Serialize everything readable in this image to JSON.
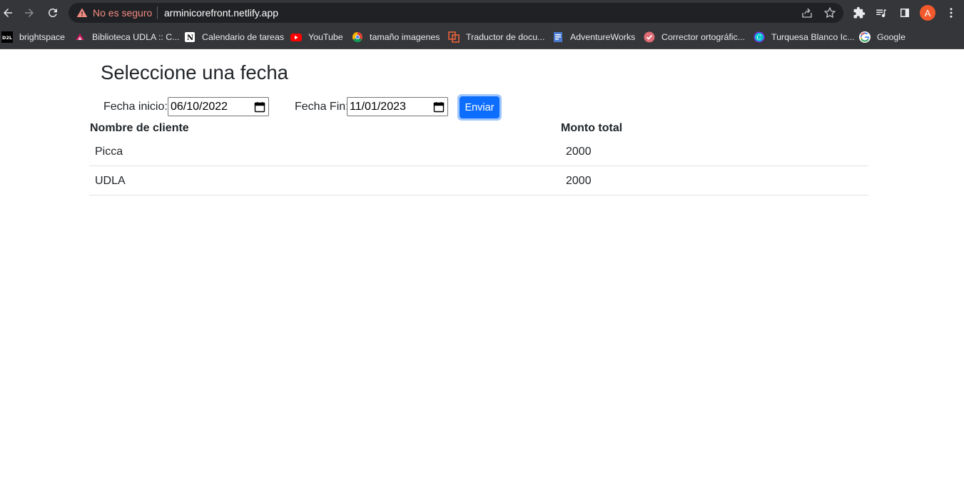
{
  "browser": {
    "security_text": "No es seguro",
    "url": "arminicorefront.netlify.app",
    "profile_initial": "A",
    "accent_color": "#f25a2c",
    "warning_color": "#f28b82",
    "icons": [
      "back-arrow-icon",
      "forward-arrow-icon",
      "reload-icon",
      "warning-icon",
      "share-icon",
      "star-icon",
      "puzzle-icon",
      "media-queue-icon",
      "side-panel-icon",
      "kebab-menu-icon"
    ]
  },
  "bookmarks": [
    {
      "label": "brightspace",
      "icon": "d2l-icon"
    },
    {
      "label": "Biblioteca UDLA :: C...",
      "icon": "udla-icon"
    },
    {
      "label": "Calendario de tareas",
      "icon": "notion-icon"
    },
    {
      "label": "YouTube",
      "icon": "youtube-icon"
    },
    {
      "label": "tamaño imagenes",
      "icon": "chrome-icon"
    },
    {
      "label": "Traductor de docu...",
      "icon": "translate-icon"
    },
    {
      "label": "AdventureWorks",
      "icon": "document-icon"
    },
    {
      "label": "Corrector ortográfic...",
      "icon": "check-icon"
    },
    {
      "label": "Turquesa Blanco Ic...",
      "icon": "canva-icon"
    },
    {
      "label": "Google",
      "icon": "google-icon"
    }
  ],
  "page": {
    "title": "Seleccione una fecha",
    "start_label": "Fecha inicio:",
    "start_value": "06/10/2022",
    "end_label": "Fecha Fin:",
    "end_value": "11/01/2023",
    "submit_label": "Enviar",
    "primary_color": "#0d6efd"
  },
  "table": {
    "headers": [
      "Nombre de cliente",
      "Monto total"
    ],
    "rows": [
      [
        "Picca",
        "2000"
      ],
      [
        "UDLA",
        "2000"
      ]
    ]
  }
}
